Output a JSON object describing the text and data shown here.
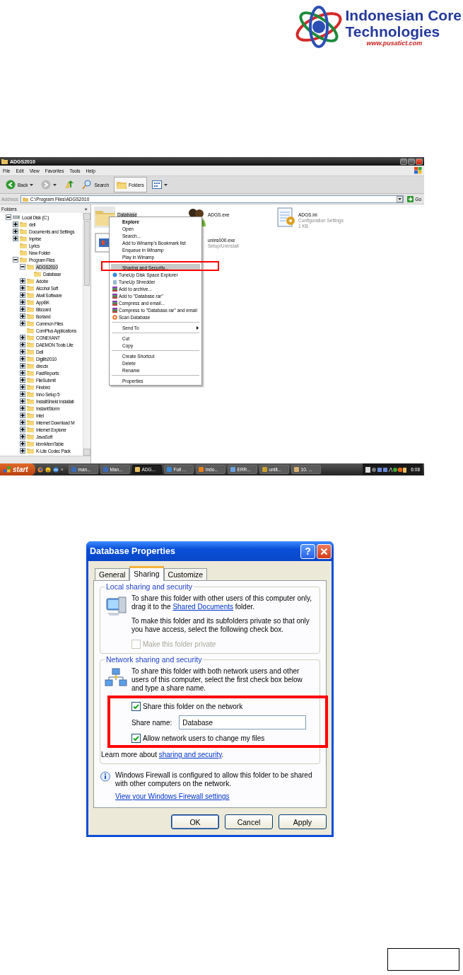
{
  "logo": {
    "line1": "Indonesian Core",
    "line2": "Technologies",
    "url": "www.pusatict.com"
  },
  "explorer": {
    "title": "ADGS2010",
    "menu": [
      "File",
      "Edit",
      "View",
      "Favorites",
      "Tools",
      "Help"
    ],
    "toolbar": [
      {
        "kind": "back",
        "label": "Back",
        "pressed": false
      },
      {
        "kind": "forward",
        "pressed": false
      },
      {
        "kind": "up",
        "pressed": false
      },
      {
        "kind": "search",
        "label": "Search",
        "pressed": false
      },
      {
        "kind": "folders",
        "label": "Folders",
        "pressed": true
      },
      {
        "kind": "views",
        "pressed": false
      }
    ],
    "address": {
      "label": "Address",
      "value": "C:\\Program Files\\ADGS2010",
      "go": "Go"
    },
    "folders_pane": {
      "title": "Folders",
      "close": "×"
    },
    "tree": [
      {
        "label": "Local Disk (C:)",
        "kind": "drive",
        "expanded": true,
        "selected": false,
        "children": [
          {
            "label": "dell",
            "kind": "folder",
            "expanded": false,
            "selected": false
          },
          {
            "label": "Documents and Settings",
            "kind": "folder",
            "expanded": false,
            "selected": false
          },
          {
            "label": "Inprise",
            "kind": "folder",
            "expanded": false,
            "selected": false
          },
          {
            "label": "Lyrics",
            "kind": "folder",
            "selected": false
          },
          {
            "label": "New Folder",
            "kind": "folder",
            "selected": false
          },
          {
            "label": "Program Files",
            "kind": "folder",
            "expanded": true,
            "selected": false,
            "children": [
              {
                "label": "ADGS2010",
                "kind": "folder",
                "expanded": true,
                "selected": true,
                "children": [
                  {
                    "label": "Database",
                    "kind": "folder",
                    "selected": false
                  }
                ]
              },
              {
                "label": "Adobe",
                "kind": "folder",
                "expanded": false,
                "selected": false
              },
              {
                "label": "Alcohol Soft",
                "kind": "folder",
                "expanded": false,
                "selected": false
              },
              {
                "label": "Alwil Software",
                "kind": "folder",
                "expanded": false,
                "selected": false
              },
              {
                "label": "AppBK",
                "kind": "folder",
                "expanded": false,
                "selected": false
              },
              {
                "label": "Blizzard",
                "kind": "folder",
                "expanded": false,
                "selected": false
              },
              {
                "label": "Borland",
                "kind": "folder",
                "expanded": false,
                "selected": false
              },
              {
                "label": "Common Files",
                "kind": "folder",
                "expanded": false,
                "selected": false
              },
              {
                "label": "ComPlus Applications",
                "kind": "folder",
                "selected": false
              },
              {
                "label": "CONEXANT",
                "kind": "folder",
                "expanded": false,
                "selected": false
              },
              {
                "label": "DAEMON Tools Lite",
                "kind": "folder",
                "expanded": false,
                "selected": false
              },
              {
                "label": "Dell",
                "kind": "folder",
                "expanded": false,
                "selected": false
              },
              {
                "label": "Digilib2010",
                "kind": "folder",
                "expanded": false,
                "selected": false
              },
              {
                "label": "directx",
                "kind": "folder",
                "expanded": false,
                "selected": false
              },
              {
                "label": "FastReports",
                "kind": "folder",
                "expanded": false,
                "selected": false
              },
              {
                "label": "FileSubmit",
                "kind": "folder",
                "expanded": false,
                "selected": false
              },
              {
                "label": "Firebird",
                "kind": "folder",
                "expanded": false,
                "selected": false
              },
              {
                "label": "Inno Setup 5",
                "kind": "folder",
                "expanded": false,
                "selected": false
              },
              {
                "label": "InstallShield Installati",
                "kind": "folder",
                "expanded": false,
                "selected": false
              },
              {
                "label": "InstantStorm",
                "kind": "folder",
                "expanded": false,
                "selected": false
              },
              {
                "label": "Intel",
                "kind": "folder",
                "expanded": false,
                "selected": false
              },
              {
                "label": "Internet Download M",
                "kind": "folder",
                "expanded": false,
                "selected": false
              },
              {
                "label": "Internet Explorer",
                "kind": "folder",
                "expanded": false,
                "selected": false
              },
              {
                "label": "JavaSoft",
                "kind": "folder",
                "expanded": false,
                "selected": false
              },
              {
                "label": "kbmMemTable",
                "kind": "folder",
                "expanded": false,
                "selected": false
              },
              {
                "label": "K-Lite Codec Pack",
                "kind": "folder",
                "expanded": false,
                "selected": false
              }
            ]
          }
        ]
      }
    ],
    "files": [
      {
        "kind": "folder",
        "name": "Database",
        "selected": true
      },
      {
        "kind": "people",
        "name": "ADGS.exe",
        "selected": false
      },
      {
        "kind": "config",
        "name": "ADGS.ini",
        "details": [
          "Configuration Settings",
          "1 KB"
        ],
        "selected": false
      },
      {
        "kind": "media",
        "selected": false
      },
      {
        "kind": "covered",
        "name": "unins000.exe",
        "details": [
          "Setup/Uninstall"
        ],
        "selected": false
      }
    ],
    "context_menu": [
      {
        "kind": "item",
        "label": "Explore",
        "default": true,
        "highlighted": false,
        "outlined": false
      },
      {
        "kind": "item",
        "label": "Open",
        "default": false,
        "highlighted": false,
        "outlined": false
      },
      {
        "kind": "item",
        "label": "Search...",
        "default": false,
        "highlighted": false,
        "outlined": false
      },
      {
        "kind": "item",
        "label": "Add to Winamp's Bookmark list",
        "default": false,
        "highlighted": false,
        "outlined": false
      },
      {
        "kind": "item",
        "label": "Enqueue in Winamp",
        "default": false,
        "highlighted": false,
        "outlined": false
      },
      {
        "kind": "item",
        "label": "Play in Winamp",
        "default": false,
        "highlighted": false,
        "outlined": false
      },
      {
        "kind": "separator"
      },
      {
        "kind": "item",
        "label": "Sharing and Security...",
        "default": false,
        "highlighted": true,
        "outlined": true
      },
      {
        "kind": "disk",
        "label": "TuneUp Disk Space Explorer",
        "default": false,
        "highlighted": false,
        "outlined": false
      },
      {
        "kind": "shredder",
        "label": "TuneUp Shredder",
        "default": false,
        "highlighted": false,
        "outlined": false
      },
      {
        "kind": "archive",
        "label": "Add to archive...",
        "default": false,
        "highlighted": false,
        "outlined": false
      },
      {
        "kind": "archive",
        "label": "Add to \"Database.rar\"",
        "default": false,
        "highlighted": false,
        "outlined": false
      },
      {
        "kind": "archive",
        "label": "Compress and email...",
        "default": false,
        "highlighted": false,
        "outlined": false
      },
      {
        "kind": "archive",
        "label": "Compress to \"Database.rar\" and email",
        "default": false,
        "highlighted": false,
        "outlined": false
      },
      {
        "kind": "scan",
        "label": "Scan Database",
        "default": false,
        "highlighted": false,
        "outlined": false
      },
      {
        "kind": "separator"
      },
      {
        "kind": "submenu",
        "label": "Send To",
        "default": false,
        "highlighted": false,
        "outlined": false
      },
      {
        "kind": "separator"
      },
      {
        "kind": "item",
        "label": "Cut",
        "default": false,
        "highlighted": false,
        "outlined": false
      },
      {
        "kind": "item",
        "label": "Copy",
        "default": false,
        "highlighted": false,
        "outlined": false
      },
      {
        "kind": "separator"
      },
      {
        "kind": "item",
        "label": "Create Shortcut",
        "default": false,
        "highlighted": false,
        "outlined": false
      },
      {
        "kind": "item",
        "label": "Delete",
        "default": false,
        "highlighted": false,
        "outlined": false
      },
      {
        "kind": "item",
        "label": "Rename",
        "default": false,
        "highlighted": false,
        "outlined": false
      },
      {
        "kind": "separator"
      },
      {
        "kind": "item",
        "label": "Properties",
        "default": false,
        "highlighted": false,
        "outlined": false
      }
    ],
    "taskbar": {
      "start": "start",
      "overflow": "»",
      "tasks": [
        {
          "label": "man...",
          "kind": "doc",
          "active": false
        },
        {
          "label": "Man...",
          "kind": "doc",
          "active": false
        },
        {
          "label": "ADG...",
          "kind": "folder",
          "active": true
        },
        {
          "label": "Full ...",
          "kind": "globe",
          "active": false
        },
        {
          "label": "Indo...",
          "kind": "browser",
          "active": false
        },
        {
          "label": "ERR...",
          "kind": "file",
          "active": false
        },
        {
          "label": "untit...",
          "kind": "paint",
          "active": false
        },
        {
          "label": "10. ...",
          "kind": "pen",
          "active": false
        }
      ],
      "clock": "6:08"
    }
  },
  "dialog": {
    "title": "Database Properties",
    "help": "?",
    "tabs": [
      {
        "label": "General",
        "selected": false
      },
      {
        "label": "Sharing",
        "selected": true
      },
      {
        "label": "Customize",
        "selected": false
      }
    ],
    "local_group": {
      "title": "Local sharing and security",
      "intro": {
        "before": "To share this folder with other users of this computer only, drag it to the ",
        "link": "Shared Documents",
        "after": " folder."
      },
      "private_text": "To make this folder and its subfolders private so that only you have access, select the following check box.",
      "private_checkbox": {
        "label": "Make this folder private",
        "checked": false,
        "disabled": true
      }
    },
    "network_group": {
      "title": "Network sharing and security",
      "intro": "To share this folder with both network users and other users of this computer, select the first check box below and type a share name.",
      "outlined": true,
      "share_checkbox": {
        "label": "Share this folder on the network",
        "checked": true,
        "disabled": false
      },
      "share_name": {
        "label": "Share name:",
        "value": "Database"
      },
      "allow_checkbox": {
        "label": "Allow network users to change my files",
        "checked": true,
        "disabled": false
      },
      "learn_more": {
        "before": "Learn more about ",
        "link": "sharing and security",
        "after": "."
      }
    },
    "firewall": {
      "text": "Windows Firewall is configured to allow this folder to be shared with other computers on the network.",
      "link": "View your Windows Firewall settings"
    },
    "buttons": [
      {
        "label": "OK",
        "default": true
      },
      {
        "label": "Cancel",
        "default": false
      },
      {
        "label": "Apply",
        "default": false
      }
    ]
  }
}
